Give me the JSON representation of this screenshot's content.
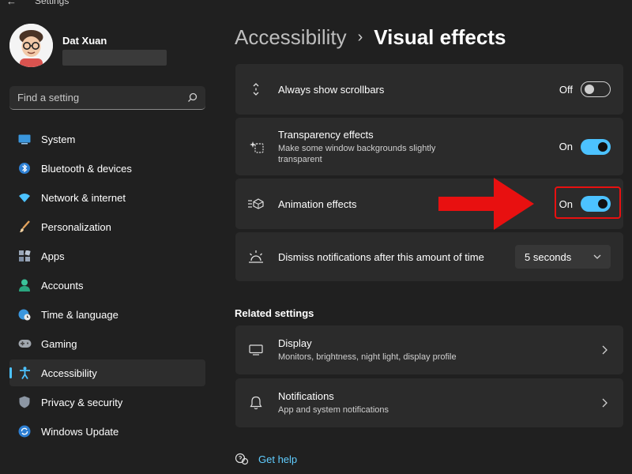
{
  "window": {
    "title": "Settings"
  },
  "profile": {
    "name": "Dat Xuan"
  },
  "search": {
    "placeholder": "Find a setting"
  },
  "sidebar": {
    "items": [
      {
        "label": "System",
        "icon": "monitor-icon",
        "active": false
      },
      {
        "label": "Bluetooth & devices",
        "icon": "bluetooth-icon",
        "active": false
      },
      {
        "label": "Network & internet",
        "icon": "wifi-icon",
        "active": false
      },
      {
        "label": "Personalization",
        "icon": "brush-icon",
        "active": false
      },
      {
        "label": "Apps",
        "icon": "apps-icon",
        "active": false
      },
      {
        "label": "Accounts",
        "icon": "person-icon",
        "active": false
      },
      {
        "label": "Time & language",
        "icon": "globe-clock-icon",
        "active": false
      },
      {
        "label": "Gaming",
        "icon": "gamepad-icon",
        "active": false
      },
      {
        "label": "Accessibility",
        "icon": "accessibility-icon",
        "active": true
      },
      {
        "label": "Privacy & security",
        "icon": "shield-icon",
        "active": false
      },
      {
        "label": "Windows Update",
        "icon": "update-icon",
        "active": false
      }
    ]
  },
  "breadcrumb": {
    "parent": "Accessibility",
    "separator": "›",
    "current": "Visual effects"
  },
  "settings": {
    "scrollbars": {
      "title": "Always show scrollbars",
      "state": "Off"
    },
    "transparency": {
      "title": "Transparency effects",
      "description_line1": "Make some window backgrounds slightly",
      "description_line2": "transparent",
      "state": "On"
    },
    "animation": {
      "title": "Animation effects",
      "state": "On"
    },
    "notifications_dismiss": {
      "title": "Dismiss notifications after this amount of time",
      "value": "5 seconds"
    }
  },
  "related": {
    "heading": "Related settings",
    "display": {
      "title": "Display",
      "description": "Monitors, brightness, night light, display profile"
    },
    "notifications": {
      "title": "Notifications",
      "description": "App and system notifications"
    }
  },
  "help": {
    "label": "Get help"
  },
  "colors": {
    "accent": "#4cc2ff",
    "highlight": "#e81010",
    "background": "#202020",
    "card": "#2b2b2b"
  }
}
